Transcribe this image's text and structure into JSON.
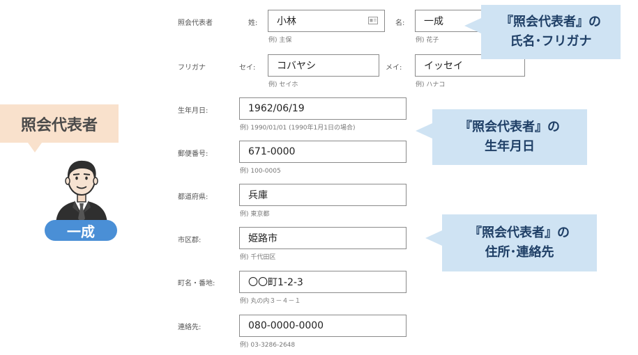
{
  "persona": {
    "bubble_label": "照会代表者",
    "name_label": "一成"
  },
  "form": {
    "name_row": {
      "label": "照会代表者",
      "last_label": "姓:",
      "last_value": "小林",
      "last_hint": "例) 主保",
      "first_label": "名:",
      "first_value": "一成",
      "first_hint": "例) 花子"
    },
    "kana_row": {
      "label": "フリガナ",
      "last_label": "セイ:",
      "last_value": "コバヤシ",
      "last_hint": "例) セイホ",
      "first_label": "メイ:",
      "first_value": "イッセイ",
      "first_hint": "例) ハナコ"
    },
    "birth": {
      "label": "生年月日:",
      "value": "1962/06/19",
      "hint": "例) 1990/01/01 (1990年1月1日の場合)"
    },
    "postal": {
      "label": "郵便番号:",
      "value": "671-0000",
      "hint": "例) 100-0005"
    },
    "prefecture": {
      "label": "都道府県:",
      "value": "兵庫",
      "hint": "例) 東京都"
    },
    "city": {
      "label": "市区郡:",
      "value": "姫路市",
      "hint": "例) 千代田区"
    },
    "street": {
      "label": "町名・番地:",
      "value": "〇〇町1-2-3",
      "hint": "例) 丸の内３－４－１"
    },
    "phone": {
      "label": "連絡先:",
      "value": "080-0000-0000",
      "hint": "例) 03-3286-2648"
    }
  },
  "callouts": {
    "name": {
      "line1": "『照会代表者』の",
      "line2": "氏名･フリガナ"
    },
    "birth": {
      "line1": "『照会代表者』の",
      "line2": "生年月日"
    },
    "address": {
      "line1": "『照会代表者』の",
      "line2": "住所･連絡先"
    }
  },
  "colors": {
    "bubble": "#f9e1cc",
    "pill": "#4a8fd6",
    "callout_bg": "#cfe3f3",
    "callout_text": "#1f3f66"
  },
  "icons": {
    "autofill": "contact-card-icon",
    "avatar": "businessman-avatar-icon"
  }
}
